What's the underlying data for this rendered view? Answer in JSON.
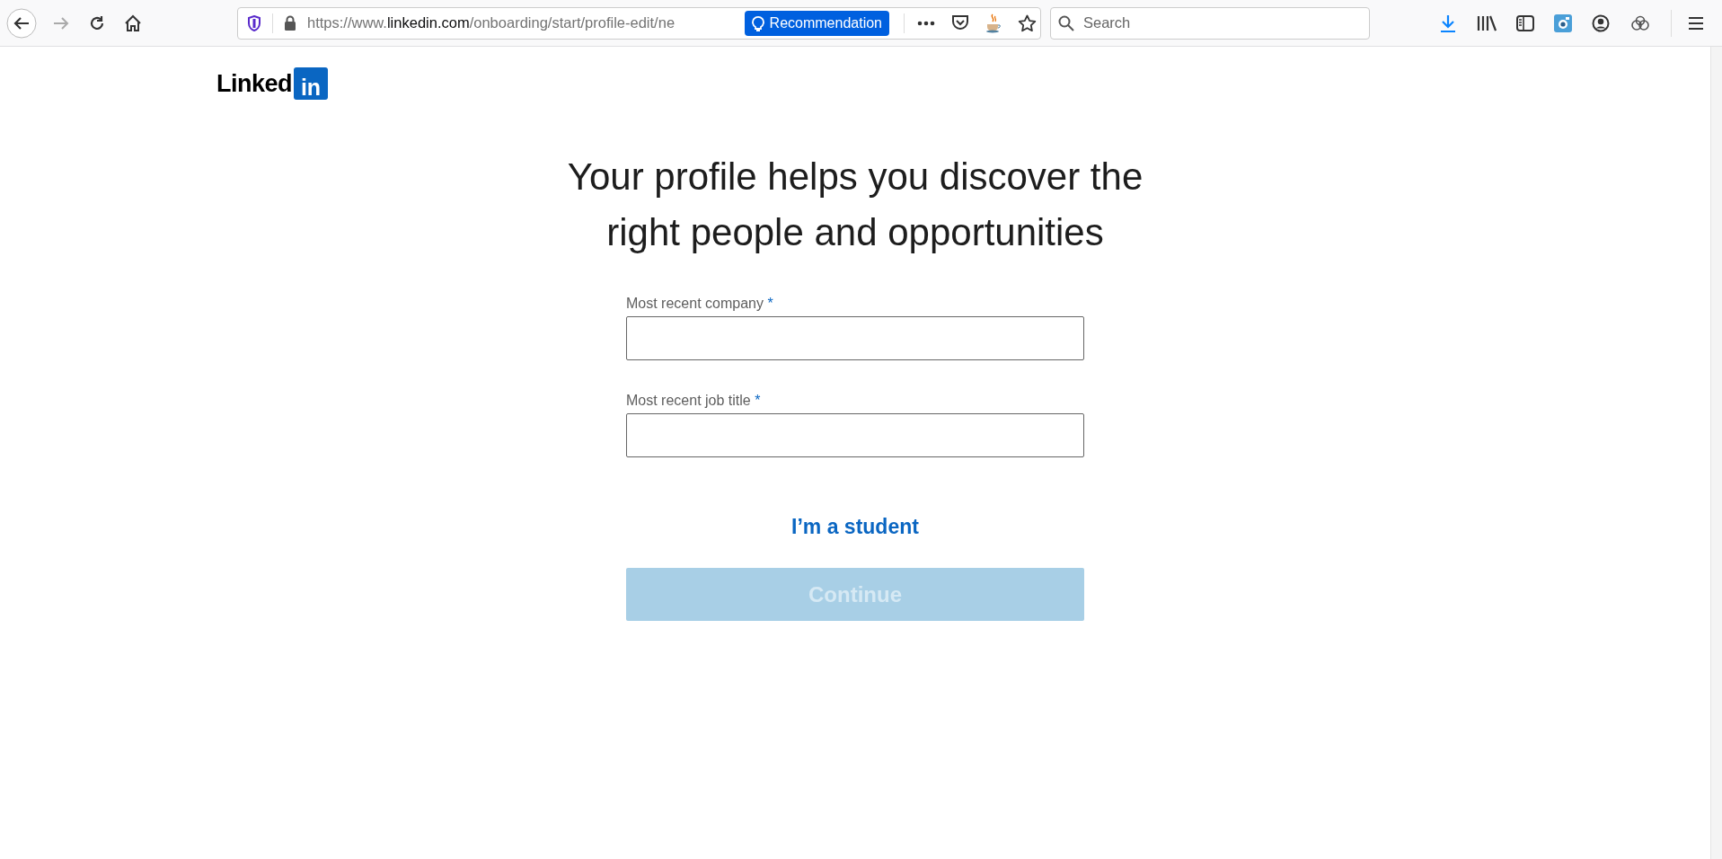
{
  "browser": {
    "nav_buttons": [
      {
        "kind": "back",
        "disabled": false
      },
      {
        "kind": "forward",
        "disabled": true
      },
      {
        "kind": "reload",
        "disabled": false
      },
      {
        "kind": "home",
        "disabled": false
      }
    ],
    "url": {
      "scheme": "https://www.",
      "host": "linkedin.com",
      "path": "/onboarding/start/profile-edit/ne"
    },
    "recommendation_button": "Recommendation",
    "url_actions": [
      {
        "kind": "more"
      },
      {
        "kind": "pocket"
      },
      {
        "kind": "cup"
      },
      {
        "kind": "star"
      }
    ],
    "search": {
      "placeholder": "Search"
    },
    "toolbar_icons": [
      {
        "kind": "download"
      },
      {
        "kind": "library"
      },
      {
        "kind": "sidebar"
      },
      {
        "kind": "camera"
      },
      {
        "kind": "account"
      },
      {
        "kind": "extension"
      },
      {
        "kind": "menu"
      }
    ]
  },
  "logo": {
    "word": "Linked",
    "badge": "in"
  },
  "heading": [
    "Your profile helps you discover the",
    "right people and opportunities"
  ],
  "fields": [
    {
      "label": "Most recent company",
      "required_mark": "*"
    },
    {
      "label": "Most recent job title",
      "required_mark": "*"
    }
  ],
  "student_link": "I’m a student",
  "continue_button": {
    "label": "Continue",
    "disabled": true
  }
}
